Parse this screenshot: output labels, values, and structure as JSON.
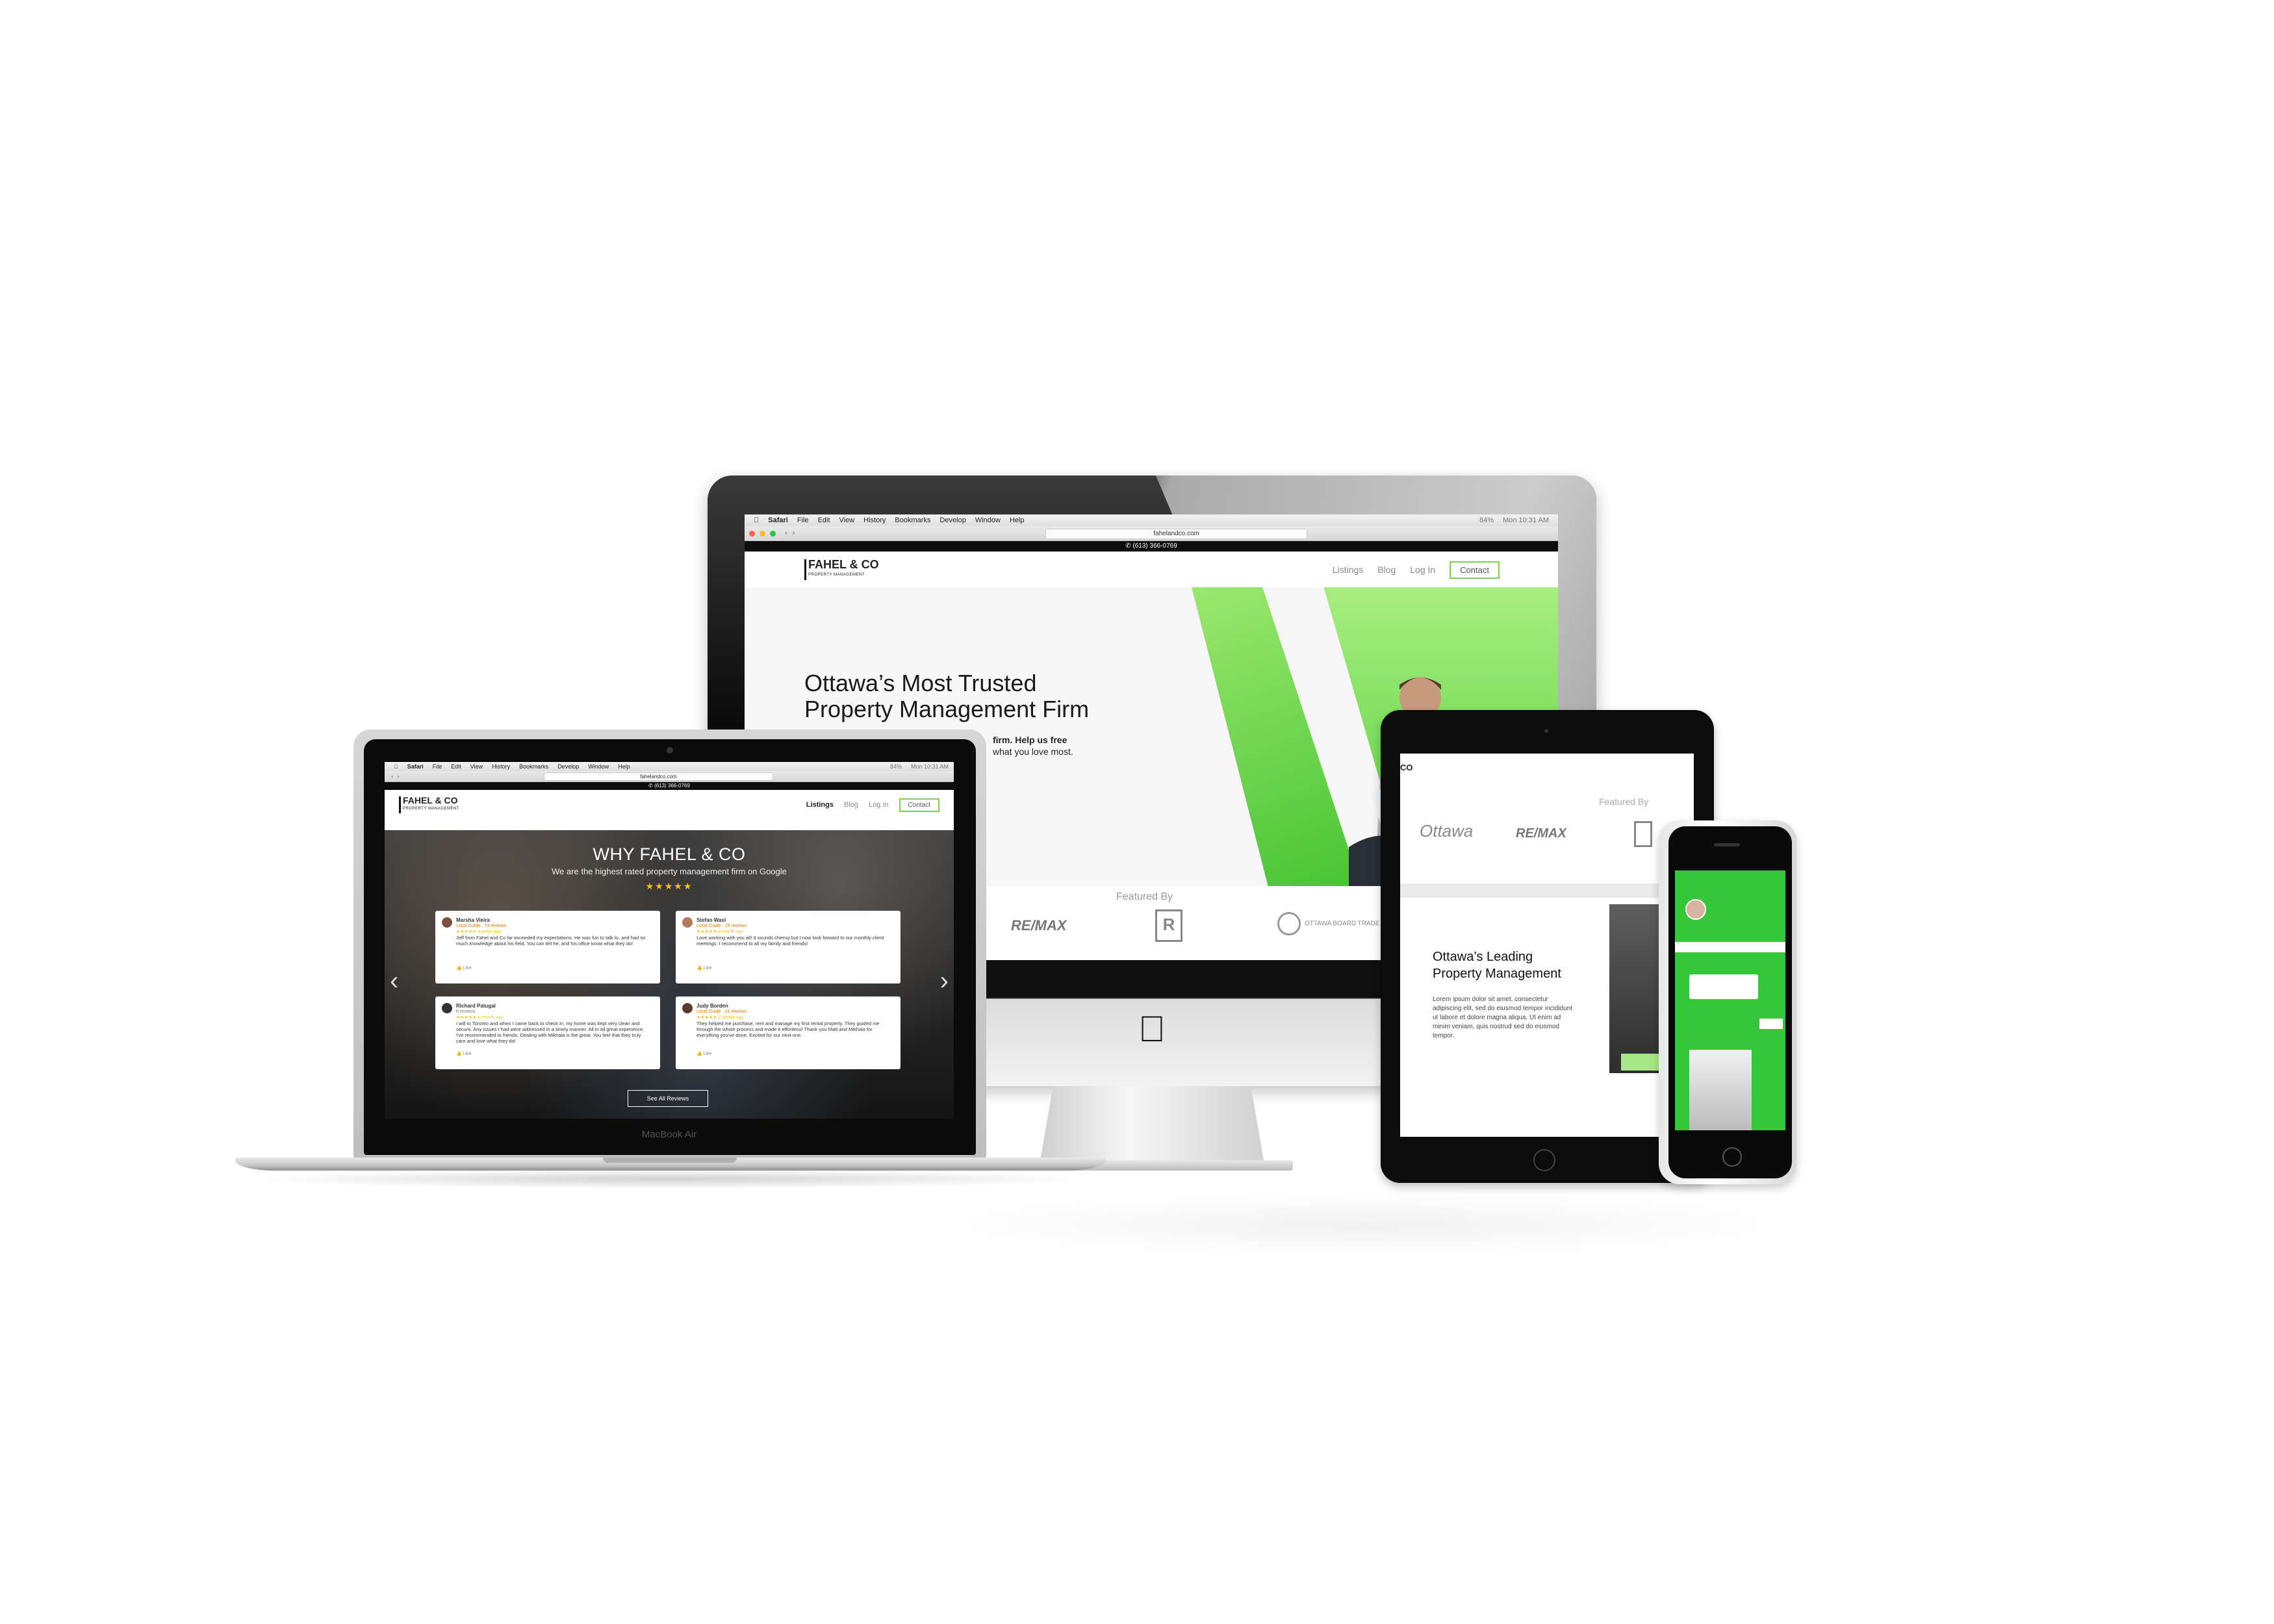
{
  "mac_menu": {
    "app": "Safari",
    "items": [
      "File",
      "Edit",
      "View",
      "History",
      "Bookmarks",
      "Develop",
      "Window",
      "Help"
    ],
    "clock": "Mon 10:31 AM",
    "battery": "84%"
  },
  "imac": {
    "url": "fahelandco.com",
    "phone": "(613) 366-0769",
    "logo": "FAHEL & CO",
    "logo_sub": "PROPERTY MANAGEMENT",
    "nav": {
      "listings": "Listings",
      "blog": "Blog",
      "login": "Log In",
      "contact": "Contact"
    },
    "hero_title_1": "Ottawa’s Most Trusted",
    "hero_title_2": "Property Management Firm",
    "hero_sub_1": "firm. Help us free",
    "hero_sub_2": "what you love most.",
    "featured_title": "Featured By",
    "featured_logos": [
      "RE/MAX",
      "R",
      "OTTAWA BOARD TRADE"
    ]
  },
  "macbook": {
    "label": "MacBook Air",
    "url": "fahelandco.com",
    "phone": "(613) 366-0769",
    "logo": "FAHEL & CO",
    "logo_sub": "PROPERTY MANAGEMENT",
    "nav": {
      "listings": "Listings",
      "blog": "Blog",
      "login": "Log In",
      "contact": "Contact"
    },
    "why_title": "WHY FAHEL & CO",
    "why_sub": "We are the highest rated property management firm on Google",
    "stars": "★★★★★",
    "reviews": [
      {
        "name": "Marsha Vieira",
        "meta": "Local Guide · 74 reviews",
        "when": "★★★★★ a week ago",
        "text": "Jeff from Fahel and Co far exceeded my expectations. He was fun to talk to, and had so much knowledge about his field. You can tell he, and his office know what they do!",
        "like": "Like"
      },
      {
        "name": "Stefan Wasl",
        "meta": "Local Guide · 15 reviews",
        "when": "★★★★★ a month ago",
        "text": "Love working with you all! It sounds cheesy but I now look forward to our monthly client meetings. I recommend to all my family and friends!",
        "like": "Like"
      },
      {
        "name": "Richard Patugal",
        "meta": "6 reviews",
        "when": "★★★★★ a month ago",
        "text": "I will to Toronto and when I came back to check in, my home was kept very clean and secure. Any issues I had were addressed in a timely manner. All in all great experience. I've recommended to friends. Dealing with Mikhala is the great. You feel that they truly care and love what they do!",
        "like": "Like"
      },
      {
        "name": "Judy Borden",
        "meta": "Local Guide · 21 reviews",
        "when": "★★★★★ 2 weeks ago",
        "text": "They helped me purchase, rent and manage my first rental property. They guided me through the whole process and made it effortless! Thank you Matt and Mikhala for everything you've done. Excited for our next one.",
        "like": "Like"
      }
    ],
    "see_all": "See All Reviews"
  },
  "ipad": {
    "corner_logo": "CO",
    "featured_title": "Featured By",
    "logos": [
      "Ottawa",
      "RE/MAX"
    ],
    "heading_1": "Ottawa’s Leading",
    "heading_2": "Property Management",
    "lorem": "Lorem ipsum dolor sit amet, consectetur adipiscing elit, sed do eiusmod tempor incididunt ut labore et dolore magna aliqua. Ut enim ad minim veniam, quis nostrud sed do eiusmod tempor."
  },
  "colors": {
    "accent": "#6fd14a",
    "dark": "#0d0d0d",
    "star": "#ffc400"
  }
}
